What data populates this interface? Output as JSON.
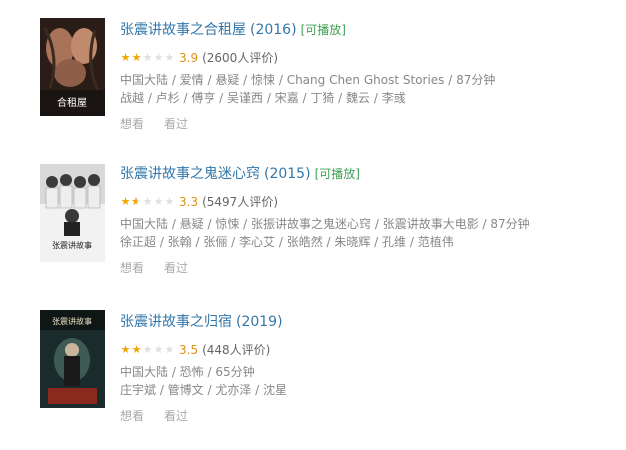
{
  "items": [
    {
      "title": "张震讲故事之合租屋",
      "year": "(2016)",
      "playable": "[可播放]",
      "stars": [
        "full",
        "full",
        "empty",
        "empty",
        "empty"
      ],
      "score": "3.9",
      "votes": "(2600人评价)",
      "meta_line1": "中国大陆 / 爱情 / 悬疑 / 惊悚 / Chang Chen Ghost Stories / 87分钟",
      "meta_line2": "战越 / 卢杉 / 傅亨 / 吴谨西 / 宋嘉 / 丁猗 / 魏云 / 李彧",
      "want": "想看",
      "seen": "看过",
      "poster_text": "合租屋"
    },
    {
      "title": "张震讲故事之鬼迷心窍",
      "year": "(2015)",
      "playable": "[可播放]",
      "stars": [
        "full",
        "half",
        "empty",
        "empty",
        "empty"
      ],
      "score": "3.3",
      "votes": "(5497人评价)",
      "meta_line1": "中国大陆 / 悬疑 / 惊悚 / 张振讲故事之鬼迷心窍 / 张震讲故事大电影 / 87分钟",
      "meta_line2": "徐正超 / 张翰 / 张俪 / 李心艾 / 张皓然 / 朱晓辉 / 孔维 / 范植伟",
      "want": "想看",
      "seen": "看过",
      "poster_text": "张震讲故事"
    },
    {
      "title": "张震讲故事之归宿",
      "year": "(2019)",
      "playable": "",
      "stars": [
        "full",
        "full",
        "empty",
        "empty",
        "empty"
      ],
      "score": "3.5",
      "votes": "(448人评价)",
      "meta_line1": "中国大陆 / 恐怖 / 65分钟",
      "meta_line2": "庄宇斌 / 管博文 / 尤亦泽 / 沈星",
      "want": "想看",
      "seen": "看过",
      "poster_text": "张震讲故事"
    }
  ],
  "colors": {
    "link": "#3377aa",
    "playable": "#3fa156",
    "star": "#f2a600",
    "score": "#e09015"
  }
}
